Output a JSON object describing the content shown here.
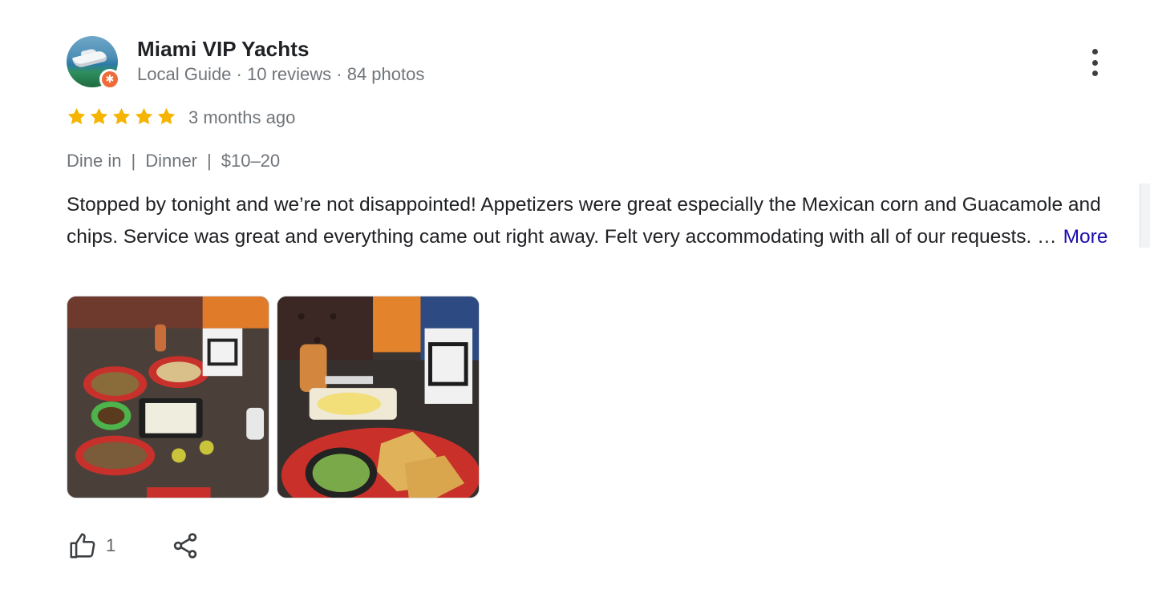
{
  "reviewer": {
    "name": "Miami VIP Yachts",
    "level": "Local Guide",
    "reviews": "10 reviews",
    "photos": "84 photos",
    "separator": " · ",
    "badge_icon": "local-guide-star-icon"
  },
  "rating": {
    "stars": 5,
    "max_stars": 5,
    "star_color": "#f4b400",
    "time_ago": "3 months ago"
  },
  "attributes": [
    "Dine in",
    "Dinner",
    "$10–20"
  ],
  "attribute_separator": "|",
  "review_text": "Stopped by tonight and we’re not disappointed! Appetizers were great especially the Mexican corn and Guacamole and chips. Service was great and everything came out right away. Felt very accommodating with all of our requests. …",
  "more_label": "More",
  "photos": [
    {
      "icon": "food-photo-icon"
    },
    {
      "icon": "food-photo-icon"
    }
  ],
  "actions": {
    "like_icon": "thumb-up-icon",
    "like_count": "1",
    "share_icon": "share-icon",
    "menu_icon": "more-vert-icon"
  },
  "colors": {
    "link": "#1a0dab",
    "secondary_text": "#70757a",
    "badge": "#ef6c3a"
  }
}
